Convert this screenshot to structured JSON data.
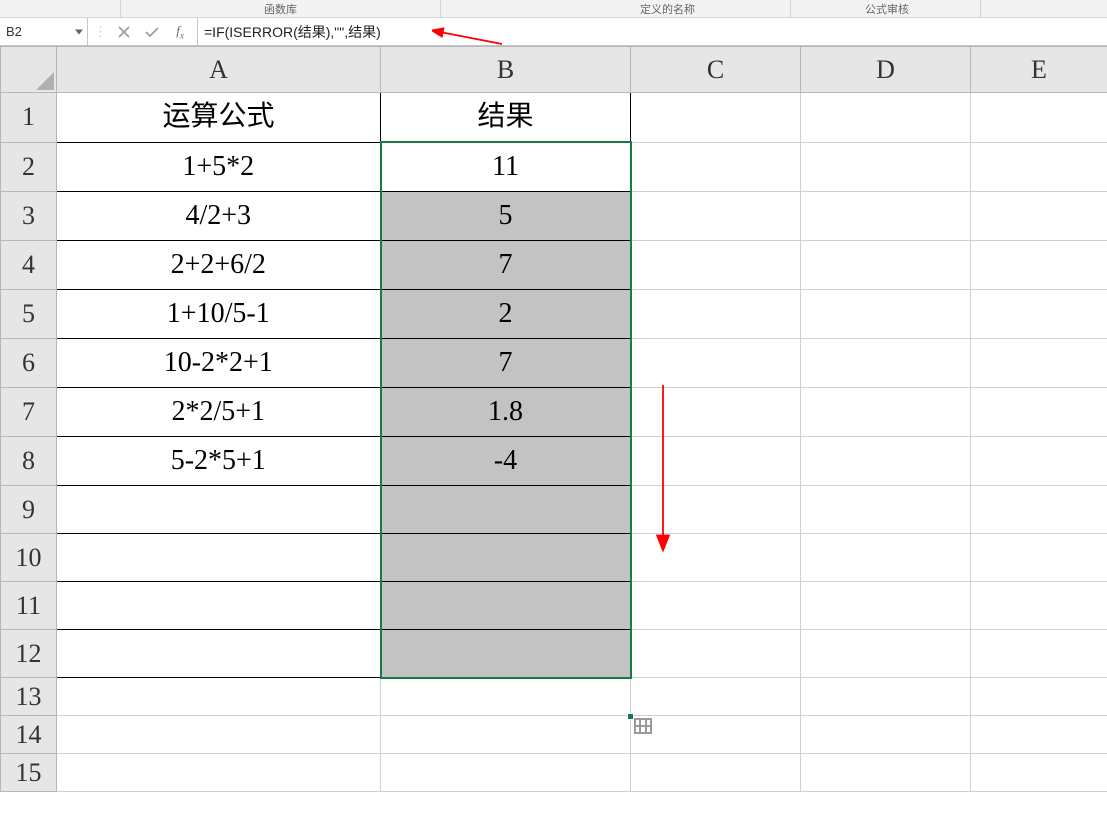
{
  "ribbon_groups": {
    "g1": "函数库",
    "g2": "定义的名称",
    "g3": "公式审核"
  },
  "name_box": {
    "value": "B2"
  },
  "formula_bar": {
    "value": "=IF(ISERROR(结果),\"\",结果)"
  },
  "columns": [
    "A",
    "B",
    "C",
    "D",
    "E"
  ],
  "row_labels": [
    "1",
    "2",
    "3",
    "4",
    "5",
    "6",
    "7",
    "8",
    "9",
    "10",
    "11",
    "12",
    "13",
    "14",
    "15"
  ],
  "chart_data": {
    "type": "table",
    "headers": {
      "A": "运算公式",
      "B": "结果"
    },
    "rows": [
      {
        "A": "1+5*2",
        "B": "11"
      },
      {
        "A": "4/2+3",
        "B": "5"
      },
      {
        "A": "2+2+6/2",
        "B": "7"
      },
      {
        "A": "1+10/5-1",
        "B": "2"
      },
      {
        "A": "10-2*2+1",
        "B": "7"
      },
      {
        "A": "2*2/5+1",
        "B": "1.8"
      },
      {
        "A": "5-2*5+1",
        "B": "-4"
      },
      {
        "A": "",
        "B": ""
      },
      {
        "A": "",
        "B": ""
      },
      {
        "A": "",
        "B": ""
      },
      {
        "A": "",
        "B": ""
      }
    ]
  },
  "selection": {
    "range": "B2:B12",
    "active": "B2"
  },
  "colors": {
    "selection_border": "#1a7a45",
    "selection_fill": "#c3c3c3",
    "arrow": "#ff0000"
  }
}
